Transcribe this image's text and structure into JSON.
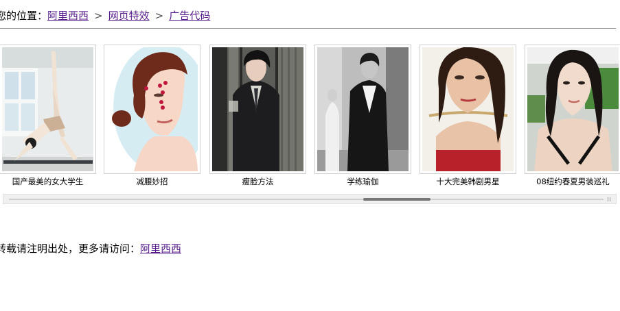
{
  "breadcrumb": {
    "prefix": "您的位置：",
    "separator": ">",
    "links": [
      "阿里西西",
      "网页特效",
      "广告代码"
    ]
  },
  "gallery": {
    "items": [
      {
        "caption": "国产最美的女大学生",
        "image": "yoga-stretch-photo"
      },
      {
        "caption": "减腰妙招",
        "image": "face-acupoints-photo"
      },
      {
        "caption": "瘦脸方法",
        "image": "man-in-suit-photo"
      },
      {
        "caption": "学练瑜伽",
        "image": "couple-street-photo"
      },
      {
        "caption": "十大完美韩剧男星",
        "image": "woman-red-top-photo"
      },
      {
        "caption": "08纽约春夏男装巡礼",
        "image": "woman-portrait-photo"
      }
    ]
  },
  "scrollbar": {
    "position": 0.59
  },
  "footer": {
    "text": "转载请注明出处，更多请访问：",
    "link": "阿里西西"
  }
}
